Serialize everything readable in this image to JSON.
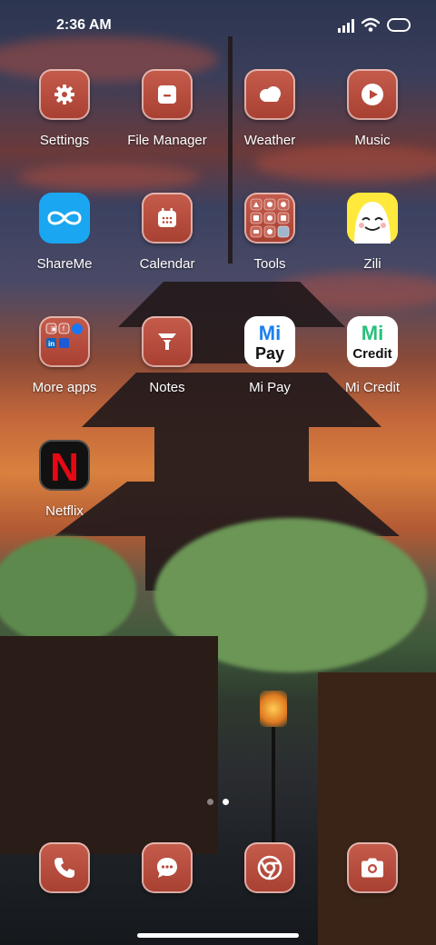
{
  "status_bar": {
    "time": "2:36 AM",
    "icons": [
      "signal-icon",
      "wifi-icon",
      "battery-icon"
    ]
  },
  "apps": [
    {
      "label": "Settings",
      "icon": "gear-icon"
    },
    {
      "label": "File Manager",
      "icon": "folder-icon"
    },
    {
      "label": "Weather",
      "icon": "cloud-icon"
    },
    {
      "label": "Music",
      "icon": "play-icon"
    },
    {
      "label": "ShareMe",
      "icon": "infinity-icon"
    },
    {
      "label": "Calendar",
      "icon": "calendar-icon"
    },
    {
      "label": "Tools",
      "icon": "tools-folder-icon"
    },
    {
      "label": "Zili",
      "icon": "zili-face-icon"
    },
    {
      "label": "More apps",
      "icon": "more-apps-folder-icon"
    },
    {
      "label": "Notes",
      "icon": "notes-icon"
    },
    {
      "label": "Mi Pay",
      "icon": "mi-pay-icon",
      "logo_text": [
        "Mi",
        "Pay"
      ]
    },
    {
      "label": "Mi Credit",
      "icon": "mi-credit-icon",
      "logo_text": [
        "Mi",
        "Credit"
      ]
    },
    {
      "label": "Netflix",
      "icon": "netflix-icon",
      "logo_text": "N"
    }
  ],
  "dock": [
    {
      "name": "phone",
      "icon": "phone-icon"
    },
    {
      "name": "messages",
      "icon": "message-icon"
    },
    {
      "name": "chrome",
      "icon": "chrome-icon"
    },
    {
      "name": "camera",
      "icon": "camera-icon"
    }
  ],
  "pager": {
    "pages": 2,
    "current": 2
  },
  "colors": {
    "theme_icon": "#b84a3c",
    "shareme": "#1aa6f0",
    "zili": "#ffe93c",
    "mi_blue": "#1a7ff0",
    "mi_green": "#27c17a",
    "netflix_red": "#e50914"
  }
}
